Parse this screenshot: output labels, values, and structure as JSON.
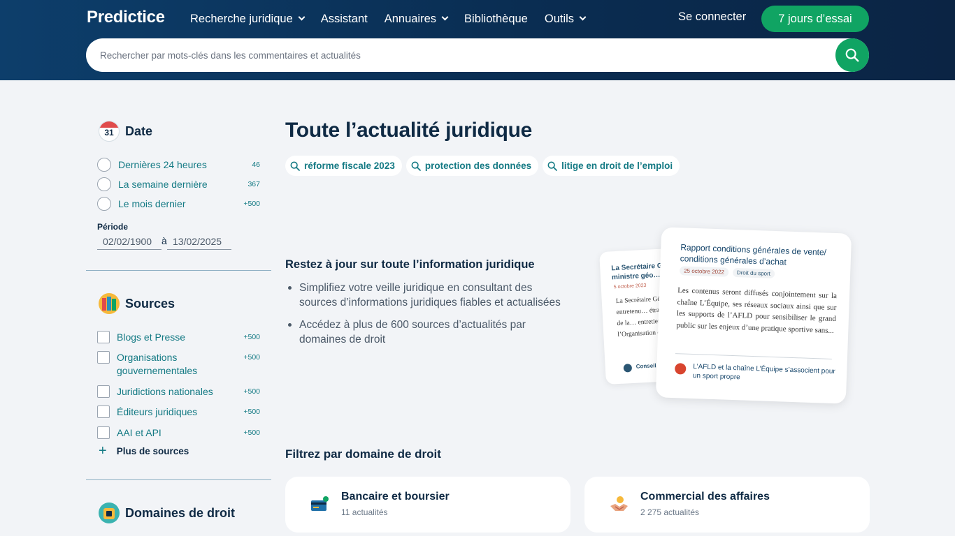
{
  "header": {
    "logo": "Predictice",
    "nav": [
      {
        "label": "Recherche juridique",
        "has_dropdown": true
      },
      {
        "label": "Assistant",
        "has_dropdown": false
      },
      {
        "label": "Annuaires",
        "has_dropdown": true
      },
      {
        "label": "Bibliothèque",
        "has_dropdown": false
      },
      {
        "label": "Outils",
        "has_dropdown": true
      }
    ],
    "login_label": "Se connecter",
    "trial_label": "7 jours d’essai",
    "search_placeholder": "Rechercher par mots-clés dans les commentaires et actualités"
  },
  "sidebar": {
    "date": {
      "title": "Date",
      "icon_day": "31",
      "options": [
        {
          "label": "Dernières 24 heures",
          "count": "46"
        },
        {
          "label": "La semaine dernière",
          "count": "367"
        },
        {
          "label": "Le mois dernier",
          "count": "+500"
        }
      ],
      "period_label": "Période",
      "from": "02/02/1900",
      "separator": "à",
      "to": "13/02/2025"
    },
    "sources": {
      "title": "Sources",
      "items": [
        {
          "label": "Blogs et Presse",
          "count": "+500"
        },
        {
          "label": "Organisations gouvernementales",
          "count": "+500"
        },
        {
          "label": "Juridictions nationales",
          "count": "+500"
        },
        {
          "label": "Éditeurs juridiques",
          "count": "+500"
        },
        {
          "label": "AAI et API",
          "count": "+500"
        }
      ],
      "more_label": "Plus de sources"
    },
    "domains": {
      "title": "Domaines de droit"
    }
  },
  "main": {
    "title": "Toute l’actualité juridique",
    "chips": [
      "réforme fiscale 2023",
      "protection des données",
      "litige en droit de l’emploi"
    ],
    "promo": {
      "title": "Restez à jour sur toute l’information juridique",
      "bullets": [
        "Simplifiez votre veille juridique en consultant des sources d’informations juridiques fiables et actualisées",
        "Accédez à plus de 600 sources d’actualités par domaines de droit"
      ]
    },
    "illustration": {
      "back_card": {
        "title": "La Secrétaire G… le ministre géo…",
        "date": "5 octobre 2023",
        "body": "La Secrétaire Gé… s’est entretenu… étrangères de la… entretien a po… l’Organisation c…",
        "source": "Conseil…"
      },
      "front_card": {
        "title": "Rapport conditions générales de vente/ conditions générales d’achat",
        "date": "25 octobre 2022",
        "tag": "Droit du sport",
        "body": "Les contenus seront diffusés conjointement sur la chaîne L’Équipe, ses réseaux sociaux ainsi que sur les supports de l’AFLD pour sensibiliser le grand public sur les enjeux d’une pratique sportive sans...",
        "source": "L’AFLD et la chaîne L’Équipe s’associent pour un sport propre"
      }
    },
    "filter_title": "Filtrez par domaine de droit",
    "domains": [
      {
        "name": "Bancaire et boursier",
        "count": "11 actualités"
      },
      {
        "name": "Commercial des affaires",
        "count": "2 275 actualités"
      }
    ]
  },
  "colors": {
    "header_bg": "#0b3358",
    "accent_green": "#10a463",
    "link_teal": "#147a84",
    "page_bg": "#f2f4f7"
  }
}
